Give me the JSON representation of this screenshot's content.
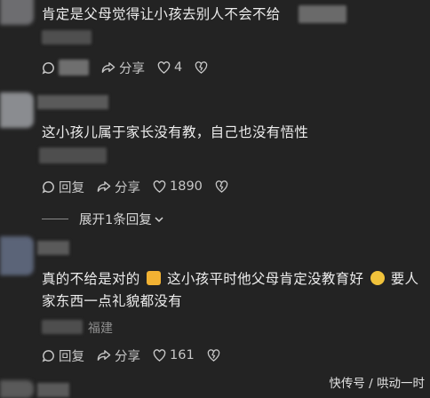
{
  "comments": [
    {
      "text": "肯定是父母觉得让小孩去别人不会不给",
      "reply_label": "",
      "share_label": "分享",
      "like_count": "4"
    },
    {
      "text": "这小孩儿属于家长没有教，自己也没有悟性",
      "reply_label": "回复",
      "share_label": "分享",
      "like_count": "1890",
      "expand_label": "展开1条回复"
    },
    {
      "text_line1_a": "真的不给是对的",
      "text_line1_b": "这小孩平时他父母肯定没教育好",
      "text_line1_c": "要人",
      "text_line2": "家东西一点礼貌都没有",
      "location": "福建",
      "reply_label": "回复",
      "share_label": "分享",
      "like_count": "161",
      "emoji_1": "thumbs-up-icon",
      "emoji_2": "sad-face-icon"
    }
  ],
  "watermark": "快传号 / 哄动一时"
}
